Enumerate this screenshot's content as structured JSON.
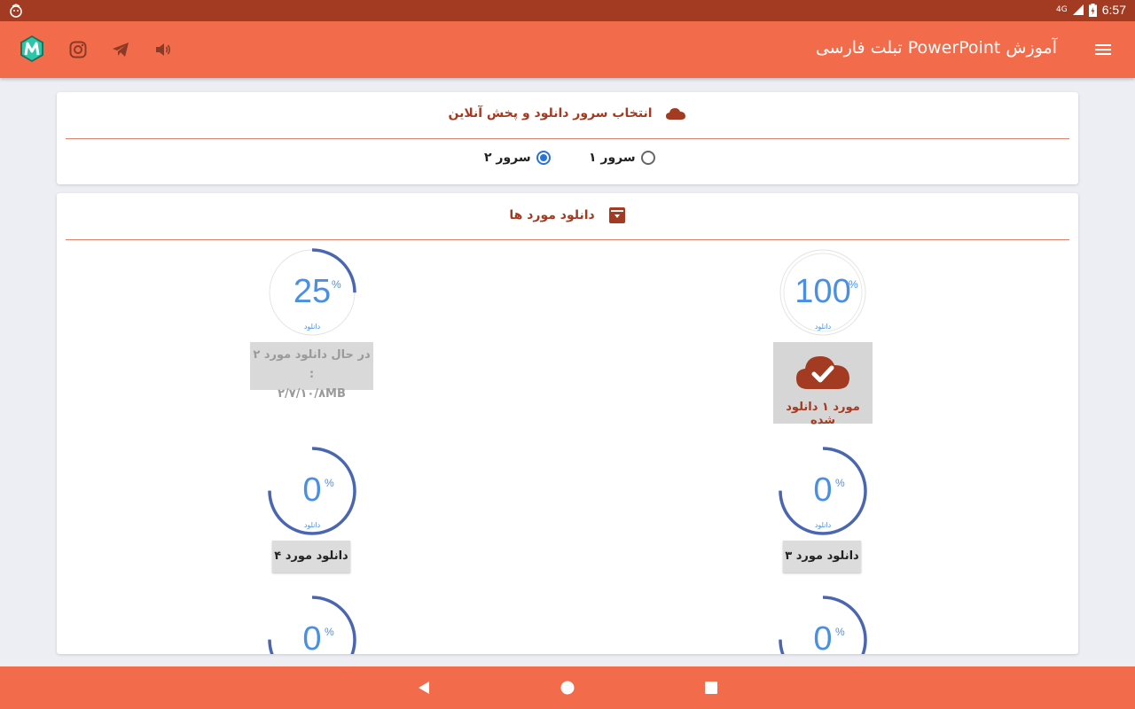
{
  "status_bar": {
    "time": "6:57",
    "network": "4G"
  },
  "app_bar": {
    "title": "آموزش PowerPoint تبلت فارسی"
  },
  "server_card": {
    "title": "انتخاب سرور دانلود و پخش آنلاین",
    "options": [
      {
        "label": "سرور ۱",
        "selected": false
      },
      {
        "label": "سرور ۲",
        "selected": true
      }
    ]
  },
  "downloads_card": {
    "title": "دانلود مورد ها",
    "gauge_caption": "دانلود",
    "percent_sign": "%",
    "items": [
      {
        "percent": "100",
        "progress": 1.0,
        "button": "مورد ۱ دانلود شده",
        "state": "done"
      },
      {
        "percent": "25",
        "progress": 0.25,
        "status_line1": "در حال دانلود مورد ۲ :",
        "status_line2": "۲/۷/۱۰/۸MB",
        "state": "downloading"
      },
      {
        "percent": "0",
        "progress": 0,
        "button": "دانلود مورد ۳",
        "state": "idle"
      },
      {
        "percent": "0",
        "progress": 0,
        "button": "دانلود مورد ۴",
        "state": "idle"
      },
      {
        "percent": "0",
        "progress": 0,
        "state": "idle"
      },
      {
        "percent": "0",
        "progress": 0,
        "state": "idle"
      }
    ]
  },
  "colors": {
    "accent": "#f26b4a",
    "status_bar": "#a33a22",
    "header_text": "#a33a22",
    "gauge_ring": "#4a66b0",
    "gauge_text": "#4a90e2"
  }
}
